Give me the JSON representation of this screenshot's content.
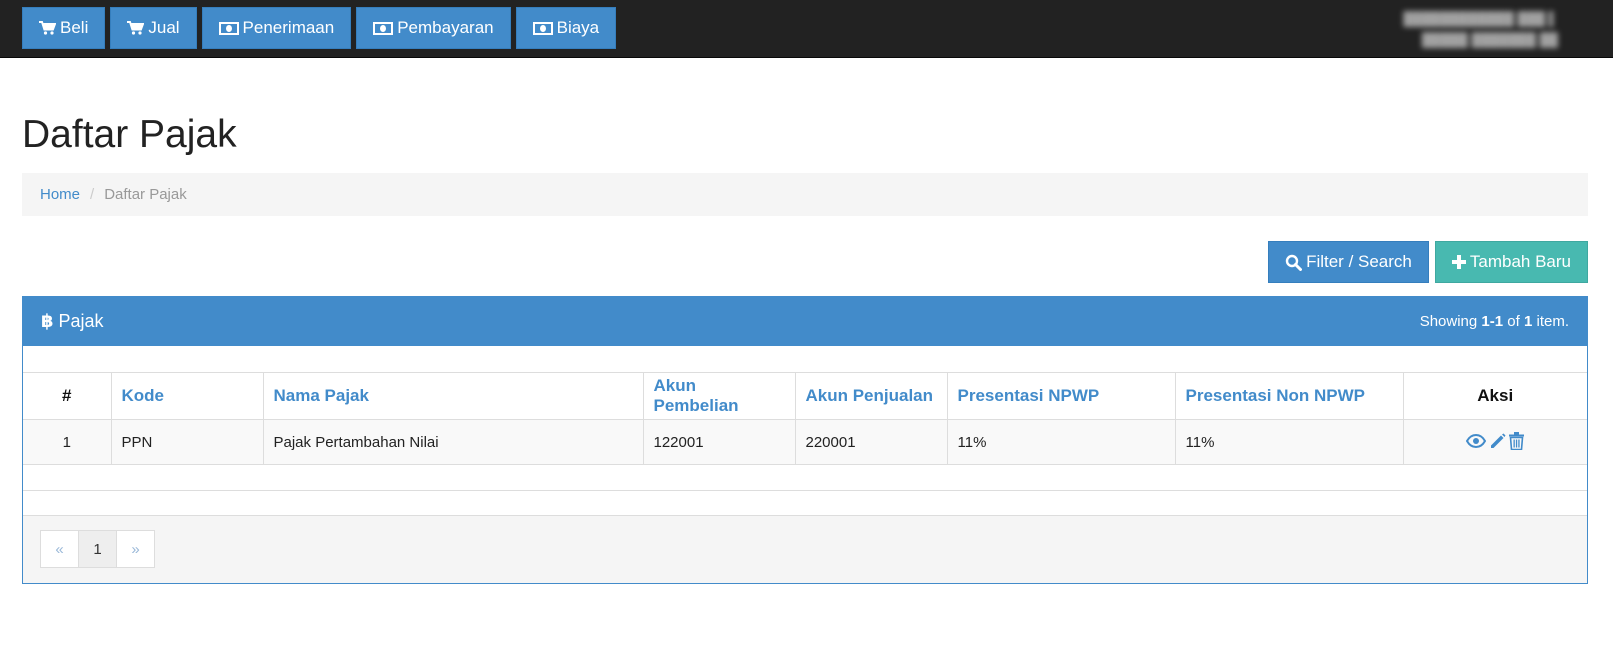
{
  "navbar": {
    "buttons": [
      {
        "label": "Beli",
        "icon": "cart-icon"
      },
      {
        "label": "Jual",
        "icon": "cart-icon"
      },
      {
        "label": "Penerimaan",
        "icon": "money-icon"
      },
      {
        "label": "Pembayaran",
        "icon": "money-icon"
      },
      {
        "label": "Biaya",
        "icon": "money-icon"
      }
    ]
  },
  "page": {
    "title": "Daftar Pajak"
  },
  "breadcrumb": {
    "home": "Home",
    "current": "Daftar Pajak"
  },
  "actions": {
    "filter_label": "Filter / Search",
    "add_label": "Tambah Baru"
  },
  "panel": {
    "title": "Pajak",
    "summary_prefix": "Showing ",
    "summary_range": "1-1",
    "summary_mid": " of ",
    "summary_total": "1",
    "summary_suffix": " item."
  },
  "table": {
    "headers": [
      "#",
      "Kode",
      "Nama Pajak",
      "Akun Pembelian",
      "Akun Penjualan",
      "Presentasi NPWP",
      "Presentasi Non NPWP",
      "Aksi"
    ],
    "rows": [
      {
        "no": "1",
        "kode": "PPN",
        "nama": "Pajak Pertambahan Nilai",
        "akun_pembelian": "122001",
        "akun_penjualan": "220001",
        "npwp": "11%",
        "non_npwp": "11%"
      }
    ]
  },
  "pagination": {
    "prev": "«",
    "page": "1",
    "next": "»"
  },
  "colors": {
    "primary": "#428bca",
    "success": "#48b9b0",
    "navbar": "#222222"
  }
}
